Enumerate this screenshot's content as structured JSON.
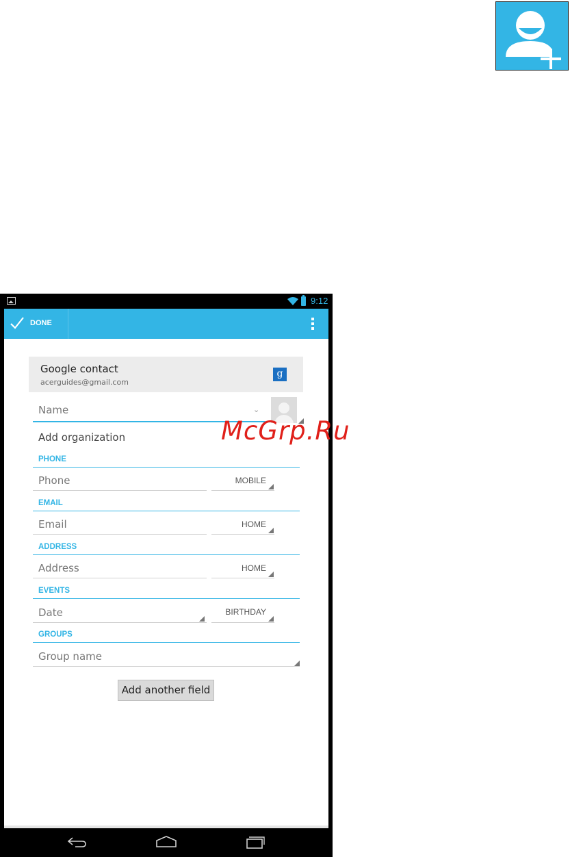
{
  "watermark": "McGrp.Ru",
  "status_bar": {
    "time": "9:12"
  },
  "action_bar": {
    "done_label": "DONE"
  },
  "account": {
    "title": "Google contact",
    "email": "acerguides@gmail.com",
    "badge": "g"
  },
  "form": {
    "name_placeholder": "Name",
    "organization_label": "Add organization",
    "sections": [
      {
        "header": "PHONE",
        "placeholder": "Phone",
        "type": "MOBILE"
      },
      {
        "header": "EMAIL",
        "placeholder": "Email",
        "type": "HOME"
      },
      {
        "header": "ADDRESS",
        "placeholder": "Address",
        "type": "HOME"
      },
      {
        "header": "EVENTS",
        "placeholder": "Date",
        "type": "BIRTHDAY"
      },
      {
        "header": "GROUPS",
        "placeholder": "Group name"
      }
    ],
    "add_field_label": "Add another field"
  },
  "colors": {
    "accent": "#33b5e5",
    "watermark": "#e0201a"
  },
  "icons": [
    "add-contact-icon",
    "check-icon",
    "overflow-menu-icon",
    "google-icon",
    "contact-photo-icon",
    "back-icon",
    "home-icon",
    "recents-icon"
  ]
}
